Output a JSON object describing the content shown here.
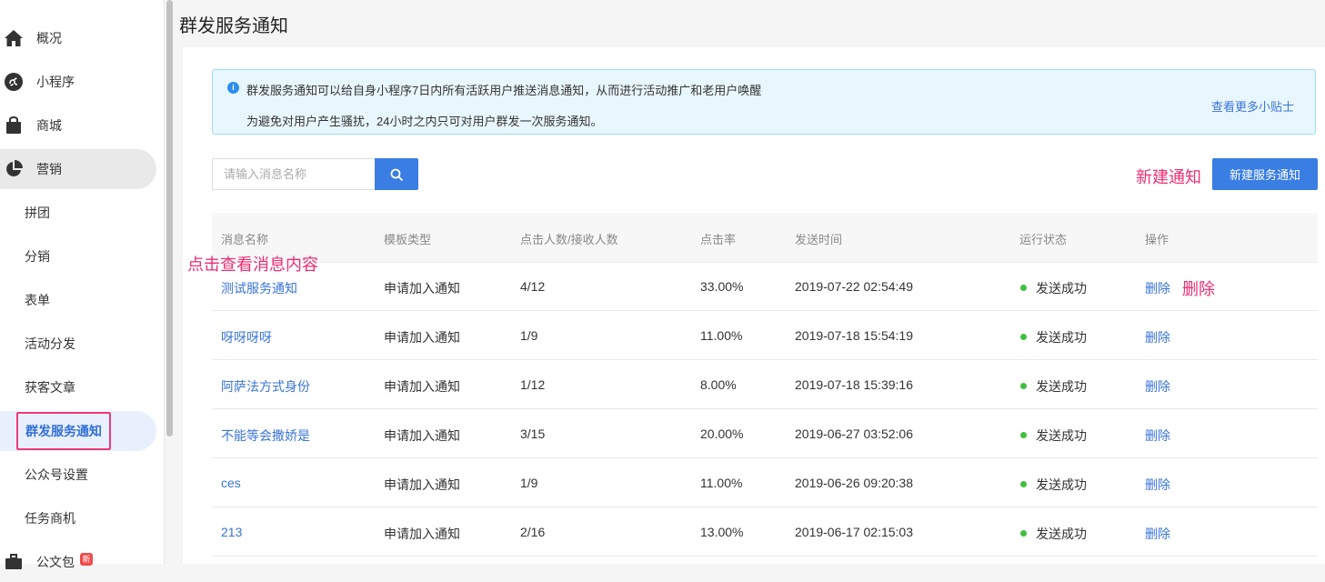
{
  "sidebar": {
    "items": [
      {
        "label": "概况",
        "icon": "home-icon"
      },
      {
        "label": "小程序",
        "icon": "mini-program-icon"
      },
      {
        "label": "商城",
        "icon": "shopping-bag-icon"
      },
      {
        "label": "营销",
        "icon": "pie-chart-icon"
      }
    ],
    "sub_items": [
      {
        "label": "拼团"
      },
      {
        "label": "分销"
      },
      {
        "label": "表单"
      },
      {
        "label": "活动分发"
      },
      {
        "label": "获客文章"
      },
      {
        "label": "群发服务通知"
      },
      {
        "label": "公众号设置"
      },
      {
        "label": "任务商机"
      }
    ],
    "partial_item": {
      "label": "公文包",
      "badge": "新"
    }
  },
  "page": {
    "title": "群发服务通知"
  },
  "info": {
    "line1": "群发服务通知可以给自身小程序7日内所有活跃用户推送消息通知，从而进行活动推广和老用户唤醒",
    "line2": "为避免对用户产生骚扰，24小时之内只可对用户群发一次服务通知。",
    "more_link": "查看更多小贴士"
  },
  "search": {
    "placeholder": "请输入消息名称"
  },
  "annotations": {
    "new": "新建通知",
    "view": "点击查看消息内容",
    "delete": "删除"
  },
  "new_button": "新建服务通知",
  "table": {
    "headers": [
      "消息名称",
      "模板类型",
      "点击人数/接收人数",
      "点击率",
      "发送时间",
      "运行状态",
      "操作"
    ],
    "rows": [
      {
        "name": "测试服务通知",
        "type": "申请加入通知",
        "clicks": "4/12",
        "rate": "33.00%",
        "time": "2019-07-22 02:54:49",
        "status": "发送成功",
        "action": "删除"
      },
      {
        "name": "呀呀呀呀",
        "type": "申请加入通知",
        "clicks": "1/9",
        "rate": "11.00%",
        "time": "2019-07-18 15:54:19",
        "status": "发送成功",
        "action": "删除"
      },
      {
        "name": "阿萨法方式身份",
        "type": "申请加入通知",
        "clicks": "1/12",
        "rate": "8.00%",
        "time": "2019-07-18 15:39:16",
        "status": "发送成功",
        "action": "删除"
      },
      {
        "name": "不能等会撒娇是",
        "type": "申请加入通知",
        "clicks": "3/15",
        "rate": "20.00%",
        "time": "2019-06-27 03:52:06",
        "status": "发送成功",
        "action": "删除"
      },
      {
        "name": "ces",
        "type": "申请加入通知",
        "clicks": "1/9",
        "rate": "11.00%",
        "time": "2019-06-26 09:20:38",
        "status": "发送成功",
        "action": "删除"
      },
      {
        "name": "213",
        "type": "申请加入通知",
        "clicks": "2/16",
        "rate": "13.00%",
        "time": "2019-06-17 02:15:03",
        "status": "发送成功",
        "action": "删除"
      }
    ]
  },
  "colors": {
    "accent": "#3a7de3",
    "annotation": "#ee2e72",
    "status_success": "#3fbf3f"
  }
}
